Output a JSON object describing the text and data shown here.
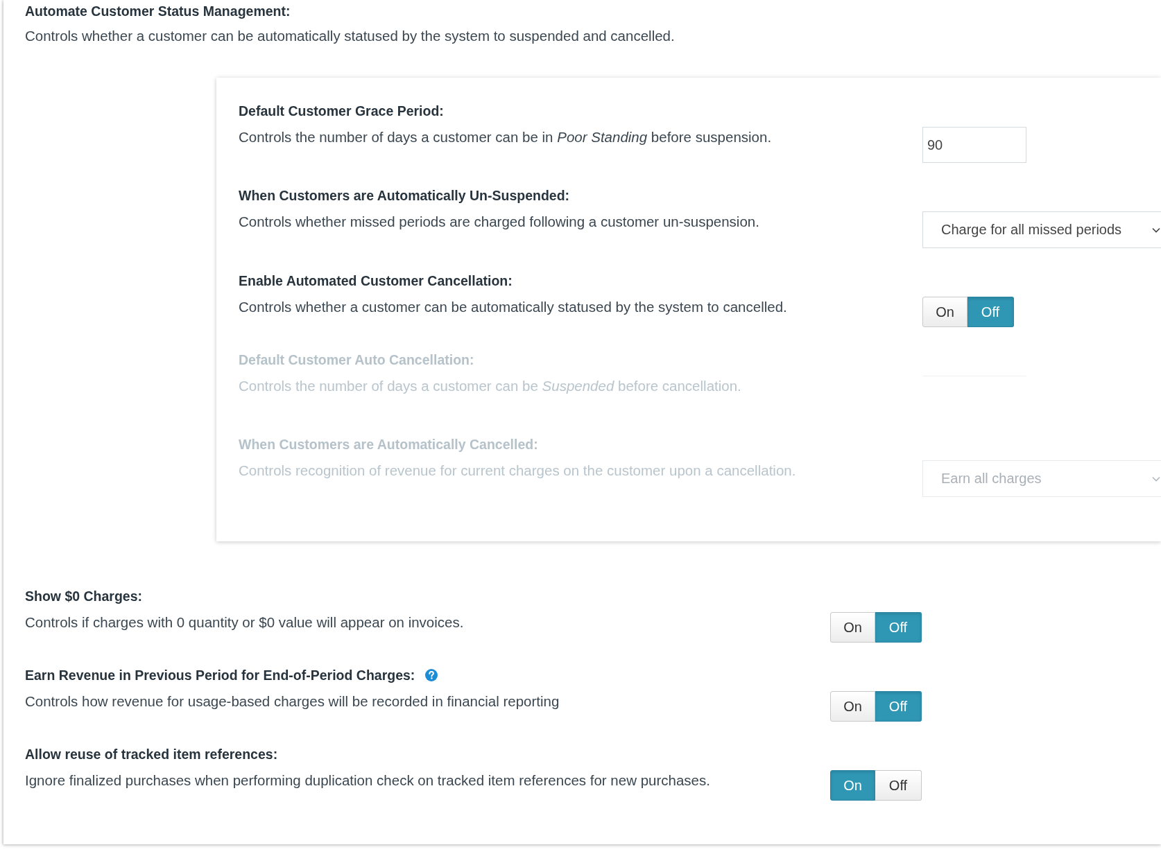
{
  "section": {
    "title": "Automate Customer Status Management:",
    "description": "Controls whether a customer can be automatically statused by the system to suspended and cancelled.",
    "settings": [
      {
        "title": "Default Customer Grace Period:",
        "description": "Controls the number of days a customer can be in *Poor Standing* before suspension.",
        "disabled": false,
        "control": {
          "kind": "number",
          "value": "90"
        }
      },
      {
        "title": "When Customers are Automatically Un-Suspended:",
        "description": "Controls whether missed periods are charged following a customer un-suspension.",
        "disabled": false,
        "control": {
          "kind": "select",
          "value": "Charge for all missed periods"
        }
      },
      {
        "title": "Enable Automated Customer Cancellation:",
        "description": "Controls whether a customer can be automatically statused by the system to cancelled.",
        "disabled": false,
        "control": {
          "kind": "toggle",
          "options": [
            {
              "label": "On",
              "selected": false
            },
            {
              "label": "Off",
              "selected": true
            }
          ]
        }
      },
      {
        "title": "Default Customer Auto Cancellation:",
        "description": "Controls the number of days a customer can be *Suspended* before cancellation.",
        "disabled": true,
        "control": {
          "kind": "number"
        }
      },
      {
        "title": "When Customers are Automatically Cancelled:",
        "description": "Controls recognition of revenue for current charges on the customer upon a cancellation.",
        "disabled": true,
        "control": {
          "kind": "select",
          "value": "Earn all charges"
        }
      }
    ]
  },
  "settings": [
    {
      "title": "Show $0 Charges:",
      "description": "Controls if charges with 0 quantity or $0 value will appear on invoices.",
      "help": false,
      "control": {
        "kind": "toggle",
        "options": [
          {
            "label": "On",
            "selected": false
          },
          {
            "label": "Off",
            "selected": true
          }
        ]
      }
    },
    {
      "title": "Earn Revenue in Previous Period for End-of-Period Charges:",
      "description": "Controls how revenue for usage-based charges will be recorded in financial reporting",
      "help": true,
      "control": {
        "kind": "toggle",
        "options": [
          {
            "label": "On",
            "selected": false
          },
          {
            "label": "Off",
            "selected": true
          }
        ]
      }
    },
    {
      "title": "Allow reuse of tracked item references:",
      "description": "Ignore finalized purchases when performing duplication check on tracked item references for new purchases.",
      "help": false,
      "control": {
        "kind": "toggle",
        "options": [
          {
            "label": "On",
            "selected": true
          },
          {
            "label": "Off",
            "selected": false
          }
        ]
      }
    }
  ]
}
